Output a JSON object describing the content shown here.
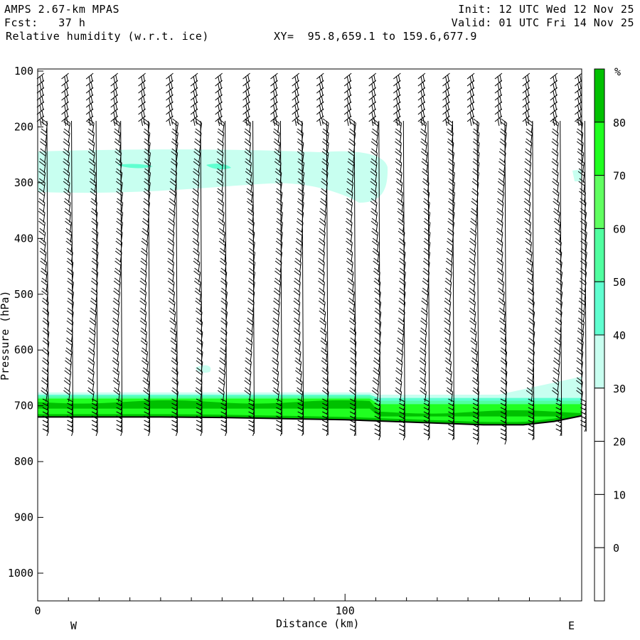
{
  "header": {
    "model": "AMPS 2.67-km MPAS",
    "forecast": "Fcst:   37 h",
    "field": "Relative humidity (w.r.t. ice)",
    "xy": "XY=  95.8,659.1 to 159.6,677.9",
    "init": "Init: 12 UTC Wed 12 Nov 25",
    "valid": "Valid: 01 UTC Fri 14 Nov 25"
  },
  "chart_data": {
    "type": "heatmap",
    "title": "Relative humidity (w.r.t. ice)",
    "xlabel": "Distance (km)",
    "ylabel": "Pressure (hPa)",
    "xlim": [
      0,
      177
    ],
    "ylim": [
      1050,
      100
    ],
    "xticks": [
      "0",
      "100"
    ],
    "xtick_values": [
      0,
      100
    ],
    "yticks": [
      "100",
      "200",
      "300",
      "400",
      "500",
      "600",
      "700",
      "800",
      "900",
      "1000"
    ],
    "ytick_values": [
      100,
      200,
      300,
      400,
      500,
      600,
      700,
      800,
      900,
      1000
    ],
    "west_label": "W",
    "east_label": "E",
    "colorbar": {
      "unit": "%",
      "labels": [
        "80",
        "70",
        "60",
        "50",
        "40",
        "30",
        "20",
        "10",
        "0"
      ],
      "levels": [
        80,
        70,
        60,
        50,
        40,
        30,
        20,
        10,
        0
      ],
      "colors": [
        "#00c000",
        "#20ff20",
        "#60ff60",
        "#50ffa0",
        "#60ffd0",
        "#c8fff0",
        "#ffffff",
        "#ffffff",
        "#ffffff",
        "#ffffff"
      ]
    },
    "terrain_hPa": [
      [
        0,
        720
      ],
      [
        40,
        720
      ],
      [
        60,
        721
      ],
      [
        80,
        723
      ],
      [
        100,
        725
      ],
      [
        115,
        728
      ],
      [
        130,
        731
      ],
      [
        145,
        734
      ],
      [
        158,
        734
      ],
      [
        168,
        728
      ],
      [
        177,
        718
      ]
    ],
    "moist_layer": {
      "top_hPa": 680,
      "rh_max": 85
    },
    "upper_layer": {
      "base_hPa": 320,
      "top_hPa": 250,
      "rh": 35,
      "x_extent_km": [
        0,
        113
      ]
    },
    "barb_columns_km": [
      3,
      11,
      19,
      27,
      36,
      45,
      53,
      61,
      70,
      79,
      86,
      94,
      103,
      111,
      119,
      127,
      135,
      143,
      152,
      161,
      170,
      178
    ]
  }
}
